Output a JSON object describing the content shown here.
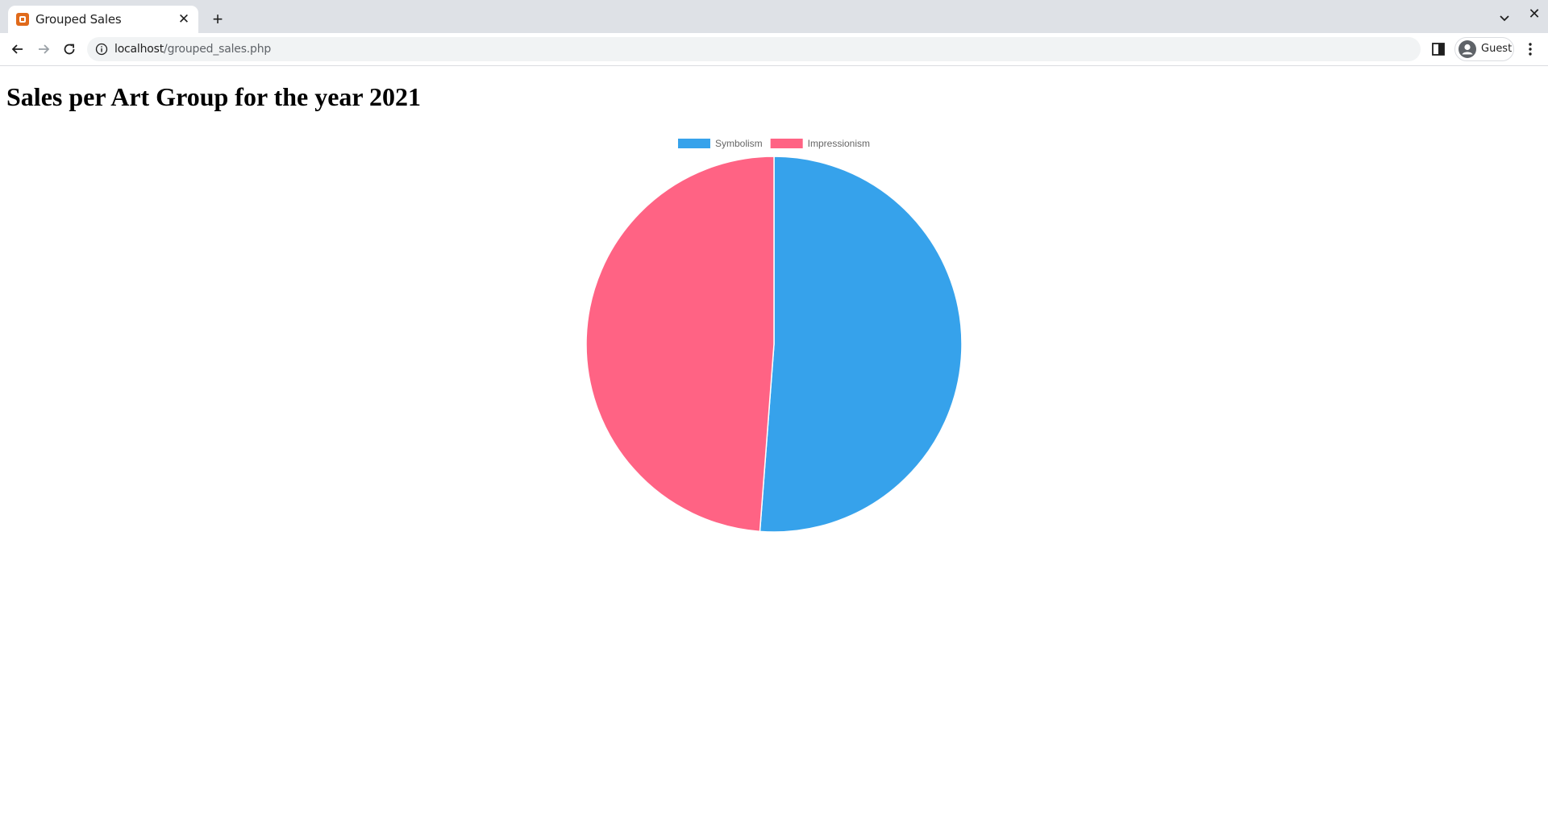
{
  "browser": {
    "tab_title": "Grouped Sales",
    "url_host": "localhost",
    "url_path": "/grouped_sales.php",
    "profile_label": "Guest"
  },
  "page": {
    "title": "Sales per Art Group for the year 2021"
  },
  "chart_data": {
    "type": "pie",
    "labels": [
      "Symbolism",
      "Impressionism"
    ],
    "values": [
      51.2,
      48.8
    ],
    "colors": [
      "#36a2eb",
      "#ff6384"
    ],
    "legend_position": "top"
  }
}
